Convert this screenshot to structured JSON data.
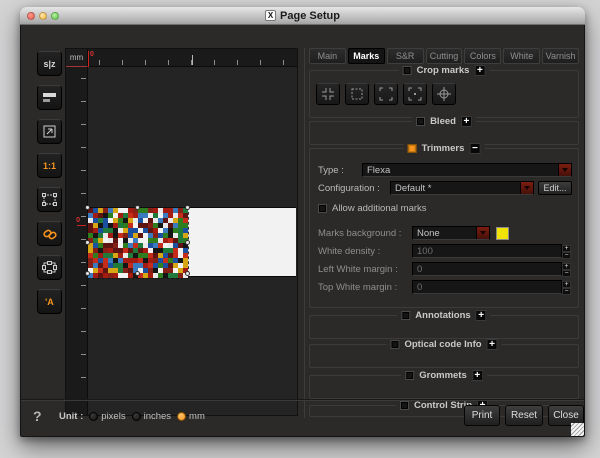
{
  "window": {
    "title": "Page Setup",
    "icon_glyph": "X"
  },
  "tabs": [
    {
      "label": "Main",
      "active": false
    },
    {
      "label": "Marks",
      "active": true
    },
    {
      "label": "S&R",
      "active": false
    },
    {
      "label": "Cutting",
      "active": false
    },
    {
      "label": "Colors",
      "active": false
    },
    {
      "label": "White",
      "active": false
    },
    {
      "label": "Varnish",
      "active": false
    }
  ],
  "toolbar": {
    "mirror_glyph": "s|z",
    "zoom_glyph": "1:1",
    "font_glyph": "'A",
    "icons": [
      "mirror",
      "align-bars",
      "open-preview",
      "zoom-one-to-one",
      "fit-frame",
      "link-chain",
      "expand-frame",
      "font"
    ]
  },
  "ruler": {
    "unit": "mm",
    "h_origin": "0",
    "v_origin": "0"
  },
  "preview": {
    "palette": [
      "#a41b12",
      "#c62c1a",
      "#2e7d1e",
      "#1b4fa0",
      "#e9e9e9",
      "#151515",
      "#d7a614",
      "#5e1410",
      "#3a7abf",
      "#207a3c",
      "#f2f2f2",
      "#842015"
    ]
  },
  "panel": {
    "crop_marks": {
      "label": "Crop marks",
      "toggle": "+",
      "checked": false,
      "icons": [
        "corner-marks",
        "dashed-frame",
        "bracket-frame",
        "bracket-dots",
        "registration-target"
      ]
    },
    "bleed": {
      "label": "Bleed",
      "toggle": "+",
      "checked": false
    },
    "trimmers": {
      "label": "Trimmers",
      "toggle": "−",
      "checked": true,
      "rows": {
        "type": {
          "label": "Type :",
          "value": "Flexa"
        },
        "configuration": {
          "label": "Configuration :",
          "value": "Default *",
          "edit": "Edit..."
        },
        "allow": {
          "label": "Allow additional marks",
          "checked": false
        },
        "marks_background": {
          "label": "Marks background :",
          "value": "None",
          "swatch": "#f2e307"
        },
        "white_density": {
          "label": "White density :",
          "value": "100"
        },
        "left_white_margin": {
          "label": "Left White margin :",
          "value": "0"
        },
        "top_white_margin": {
          "label": "Top White margin :",
          "value": "0"
        }
      },
      "stepper": {
        "up": "+",
        "down": "−"
      }
    },
    "annotations": {
      "label": "Annotations",
      "toggle": "+",
      "checked": false
    },
    "optical_code": {
      "label": "Optical code Info",
      "toggle": "+",
      "checked": false
    },
    "grommets": {
      "label": "Grommets",
      "toggle": "+",
      "checked": false
    },
    "control_strip": {
      "label": "Control Strip",
      "toggle": "+",
      "checked": false
    }
  },
  "footer": {
    "help": "?",
    "unit_label": "Unit :",
    "units": [
      {
        "label": "pixels",
        "selected": false
      },
      {
        "label": "inches",
        "selected": false
      },
      {
        "label": "mm",
        "selected": true
      }
    ],
    "buttons": {
      "print": "Print",
      "reset": "Reset",
      "close": "Close"
    }
  },
  "colors": {
    "accent_orange": "#f7941d",
    "swatch_yellow": "#f2e307",
    "dropdown_arrow_red": "#7c1e10",
    "ruler_origin_red": "#cc2222"
  }
}
